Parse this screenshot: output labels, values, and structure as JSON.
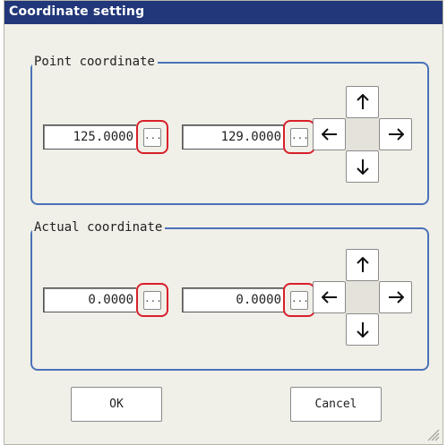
{
  "dialog": {
    "title": "Coordinate setting"
  },
  "point_group": {
    "label": "Point coordinate",
    "x_value": "125.0000",
    "y_value": "129.0000"
  },
  "actual_group": {
    "label": "Actual coordinate",
    "x_value": "0.0000",
    "y_value": "0.0000"
  },
  "common": {
    "ellipsis": "..."
  },
  "buttons": {
    "ok": "OK",
    "cancel": "Cancel"
  },
  "colors": {
    "title_bar": "#213779",
    "group_border": "#4a72b7",
    "highlight_ring": "#d8202a",
    "dialog_bg": "#f0efe8"
  },
  "icons": [
    "arrow-up-icon",
    "arrow-down-icon",
    "arrow-left-icon",
    "arrow-right-icon",
    "resize-grip-icon"
  ]
}
